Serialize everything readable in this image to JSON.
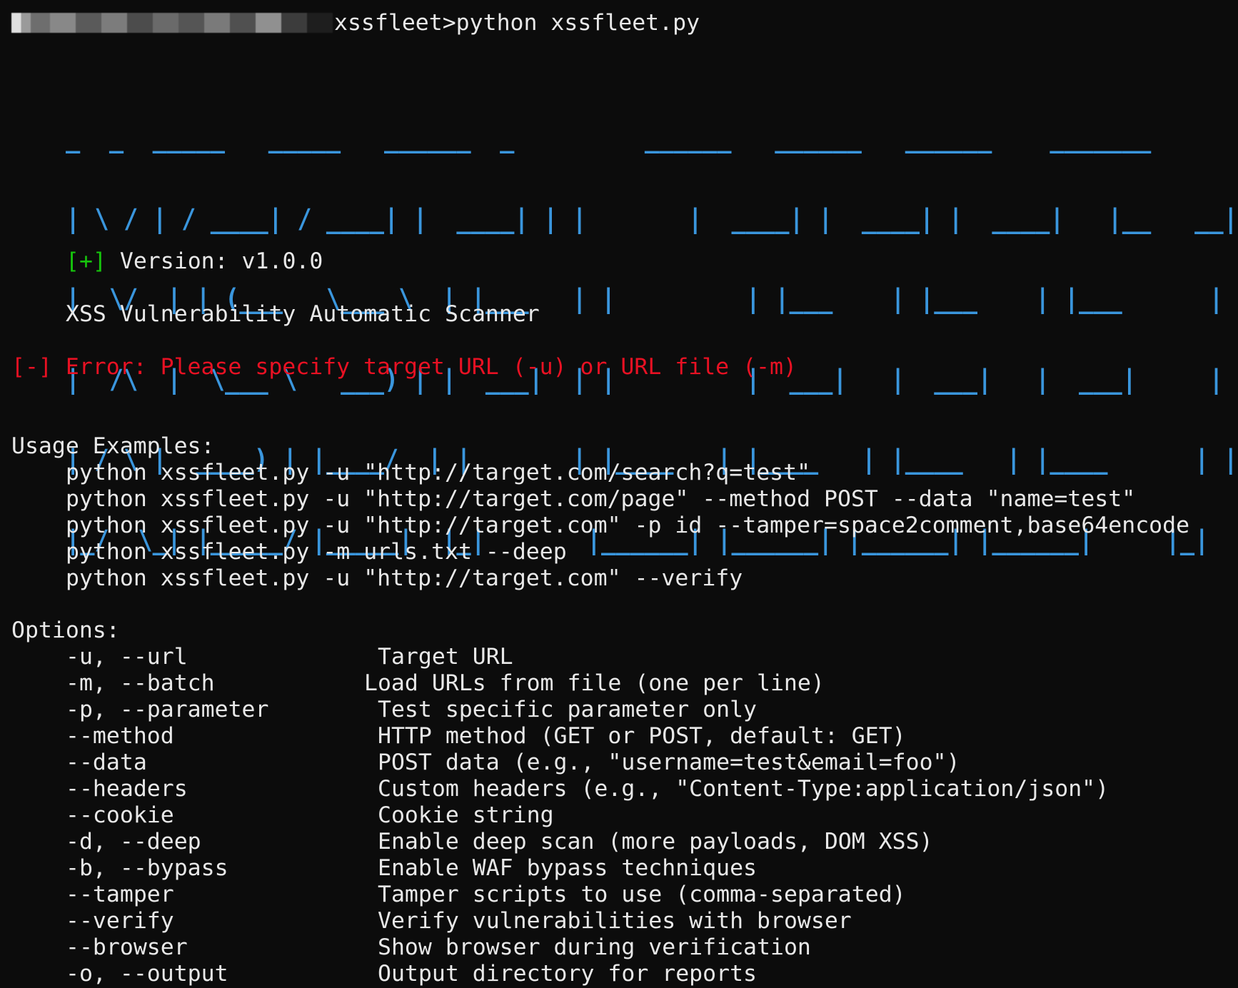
{
  "terminal": {
    "prompt_suffix": "xssfleet>python xssfleet.py",
    "logo_lines": [
      "_  _  _____   _____   ______  _         ______   ______   ______    _______",
      "| \\ / | / ____| / ____| |  ____| | |       |  ____| |  ____| |  ____|   |__   __|",
      "|  \\/  | | (___   \\___ \\  | |___   | |         | |___    | |___    | |___      | |",
      "|  /\\  |  \\___ \\   ___) | |  ___|  | |         |  ___|   |  ___|   |  ___|     | |",
      "| / \\ |  ____) | |____/  | |       | |____   | |____   | |____   | |____      | |",
      "|_/  \\_| |_____/ |_____|  |_|       |______| |______| |______| |______|     |_|"
    ],
    "version_marker": "[+]",
    "version_text": " Version: v1.0.0",
    "subtitle": "XSS Vulnerability Automatic Scanner",
    "error_text": "[-] Error: Please specify target URL (-u) or URL file (-m)",
    "usage_heading": "Usage Examples:",
    "usage_examples": [
      "python xssfleet.py -u \"http://target.com/search?q=test\"",
      "python xssfleet.py -u \"http://target.com/page\" --method POST --data \"name=test\"",
      "python xssfleet.py -u \"http://target.com\" -p id --tamper=space2comment,base64encode",
      "python xssfleet.py -m urls.txt --deep",
      "python xssfleet.py -u \"http://target.com\" --verify"
    ],
    "options_heading": "Options:",
    "options": [
      {
        "flag": "-u, --url",
        "desc": "Target URL"
      },
      {
        "flag": "-m, --batch",
        "desc": "Load URLs from file (one per line)"
      },
      {
        "flag": "-p, --parameter",
        "desc": "Test specific parameter only"
      },
      {
        "flag": "--method",
        "desc": "HTTP method (GET or POST, default: GET)"
      },
      {
        "flag": "--data",
        "desc": "POST data (e.g., \"username=test&email=foo\")"
      },
      {
        "flag": "--headers",
        "desc": "Custom headers (e.g., \"Content-Type:application/json\")"
      },
      {
        "flag": "--cookie",
        "desc": "Cookie string"
      },
      {
        "flag": "-d, --deep",
        "desc": "Enable deep scan (more payloads, DOM XSS)"
      },
      {
        "flag": "-b, --bypass",
        "desc": "Enable WAF bypass techniques"
      },
      {
        "flag": "--tamper",
        "desc": "Tamper scripts to use (comma-separated)"
      },
      {
        "flag": "--verify",
        "desc": "Verify vulnerabilities with browser"
      },
      {
        "flag": "--browser",
        "desc": "Show browser during verification"
      },
      {
        "flag": "-o, --output",
        "desc": "Output directory for reports"
      }
    ],
    "colors": {
      "background": "#0c0c0c",
      "text": "#e8e8e8",
      "logo": "#3a96dd",
      "success": "#16c60c",
      "error": "#e81123"
    }
  }
}
